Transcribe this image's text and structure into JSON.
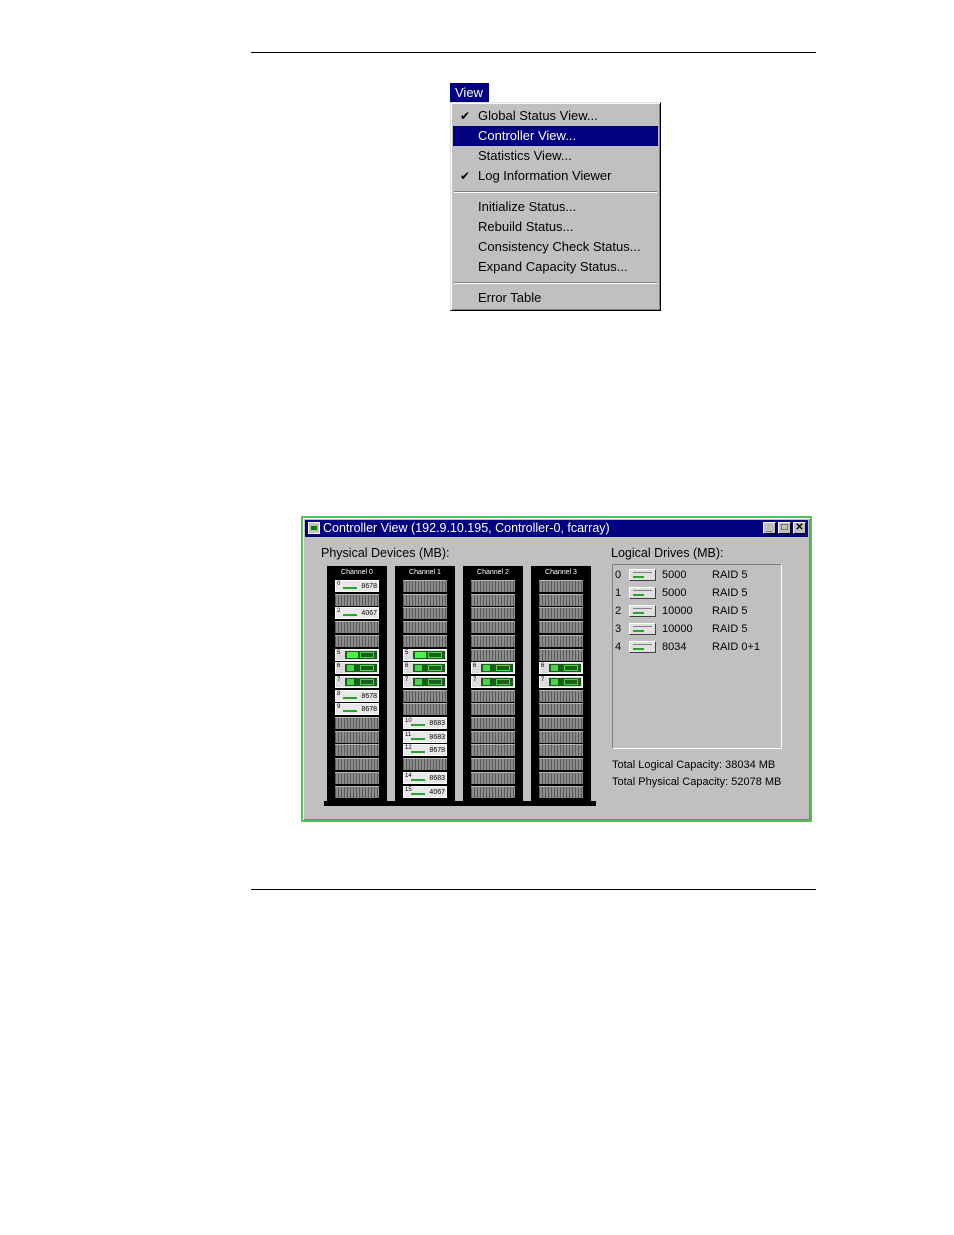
{
  "menu": {
    "title": "View",
    "items": [
      {
        "label": "Global Status View...",
        "checked": true
      },
      {
        "label": "Controller View...",
        "highlighted": true
      },
      {
        "label": "Statistics View..."
      },
      {
        "label": "Log Information Viewer",
        "checked": true
      },
      {
        "label": "Initialize Status..."
      },
      {
        "label": "Rebuild Status..."
      },
      {
        "label": "Consistency Check Status..."
      },
      {
        "label": "Expand Capacity Status..."
      },
      {
        "label": "Error Table"
      }
    ],
    "check_glyph": "✔"
  },
  "window": {
    "title": "Controller View (192.9.10.195, Controller-0, fcarray)",
    "buttons": {
      "minimize": "_",
      "maximize": "□",
      "close": "✕"
    },
    "physical_label": "Physical Devices (MB):",
    "logical_label": "Logical Drives (MB):",
    "channels": [
      {
        "name": "Channel 0",
        "slots": [
          {
            "id": "0",
            "cap": "8678"
          },
          {
            "id": "2",
            "cap": "4067"
          },
          {
            "id": "5",
            "cap": ""
          },
          {
            "id": "6",
            "cap": ""
          },
          {
            "id": "7",
            "cap": ""
          },
          {
            "id": "8",
            "cap": "8678"
          },
          {
            "id": "9",
            "cap": "8678"
          }
        ]
      },
      {
        "name": "Channel 1",
        "slots": [
          {
            "id": "5",
            "cap": ""
          },
          {
            "id": "6",
            "cap": ""
          },
          {
            "id": "7",
            "cap": ""
          },
          {
            "id": "10",
            "cap": "8683"
          },
          {
            "id": "11",
            "cap": "8683"
          },
          {
            "id": "12",
            "cap": "8678"
          },
          {
            "id": "14",
            "cap": "8683"
          },
          {
            "id": "15",
            "cap": "4067"
          }
        ]
      },
      {
        "name": "Channel 2",
        "slots": [
          {
            "id": "6",
            "cap": ""
          },
          {
            "id": "7",
            "cap": ""
          }
        ]
      },
      {
        "name": "Channel 3",
        "slots": [
          {
            "id": "6",
            "cap": ""
          },
          {
            "id": "7",
            "cap": ""
          }
        ]
      }
    ],
    "logical_drives": [
      {
        "id": "0",
        "size": "5000",
        "raid": "RAID 5"
      },
      {
        "id": "1",
        "size": "5000",
        "raid": "RAID 5"
      },
      {
        "id": "2",
        "size": "10000",
        "raid": "RAID 5"
      },
      {
        "id": "3",
        "size": "10000",
        "raid": "RAID 5"
      },
      {
        "id": "4",
        "size": "8034",
        "raid": "RAID 0+1"
      }
    ],
    "total_logical": "Total Logical Capacity:  38034 MB",
    "total_physical": "Total Physical Capacity: 52078 MB"
  }
}
